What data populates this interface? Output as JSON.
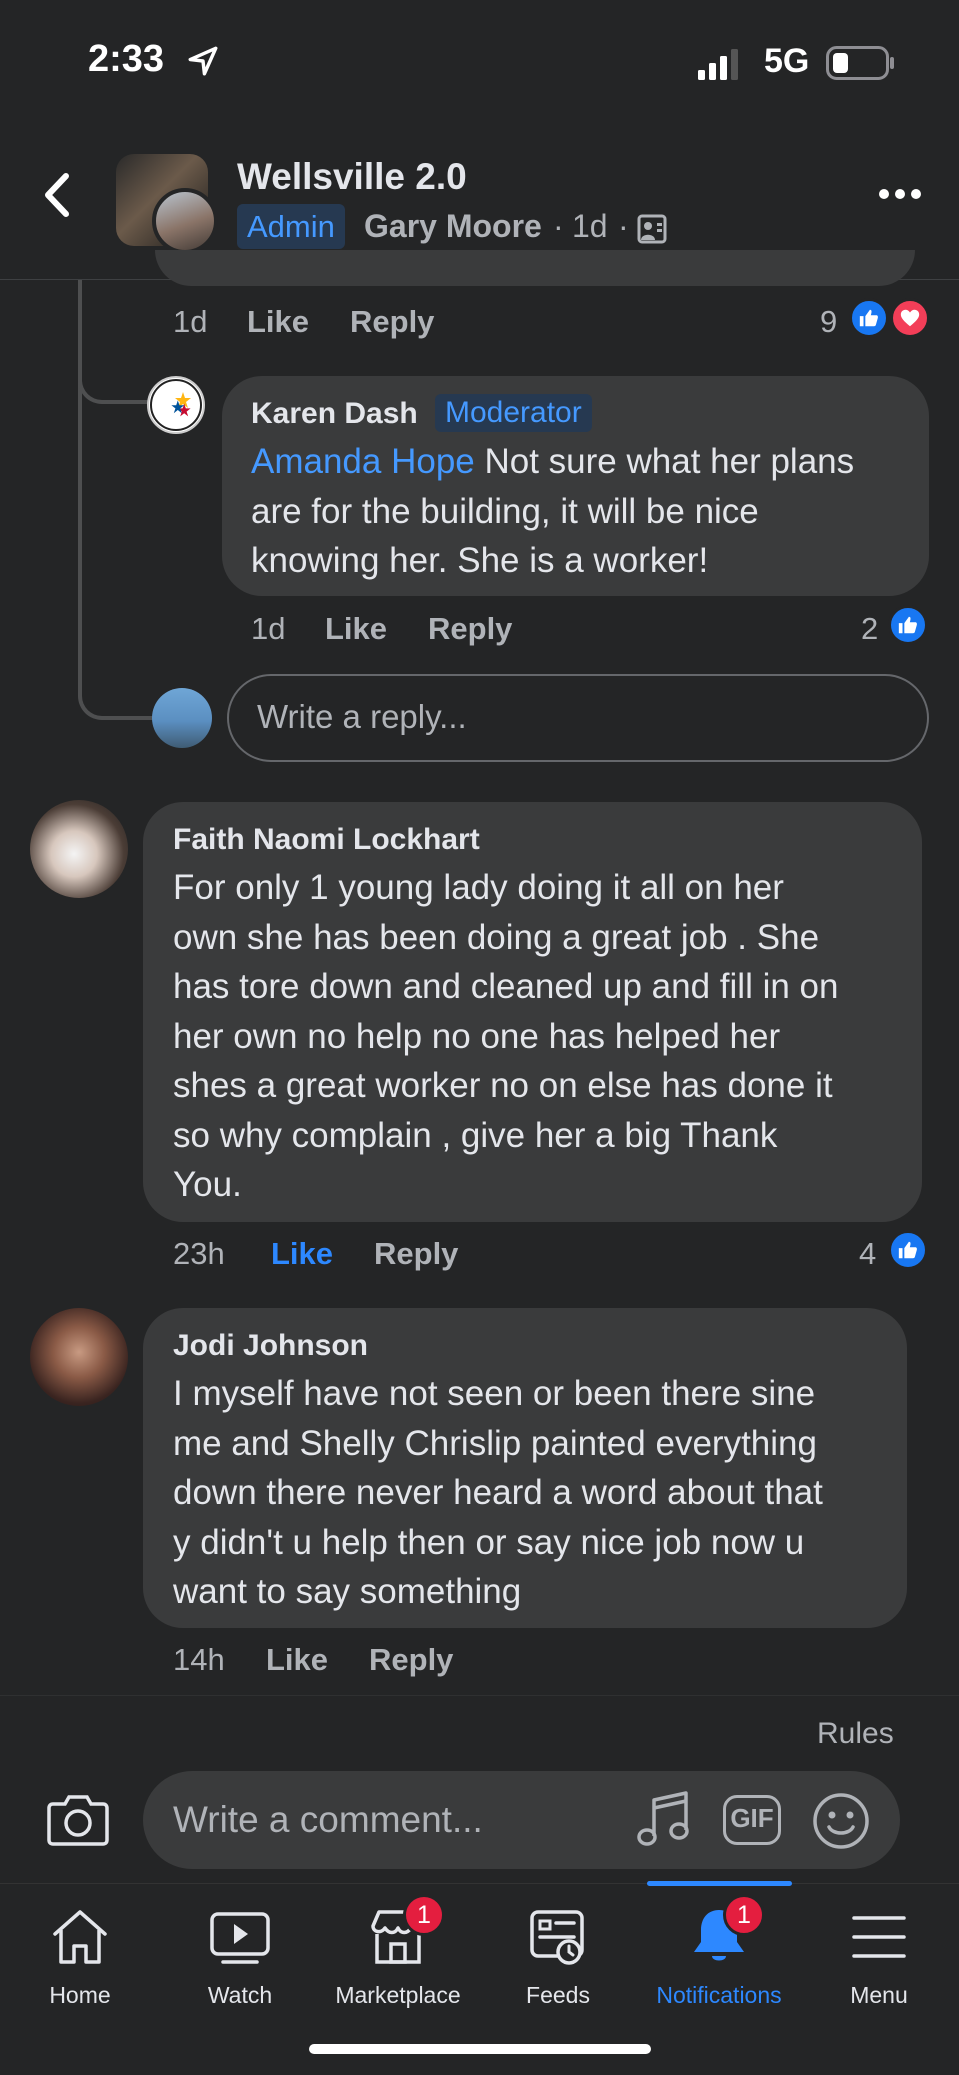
{
  "status_bar": {
    "time": "2:33",
    "network": "5G"
  },
  "header": {
    "group_name": "Wellsville 2.0",
    "role_badge": "Admin",
    "author": "Gary Moore",
    "time": "1d",
    "separator": "·"
  },
  "prev_comment_meta": {
    "time": "1d",
    "like": "Like",
    "reply": "Reply",
    "reaction_count": "9"
  },
  "reply_karen": {
    "name": "Karen Dash",
    "badge": "Moderator",
    "mention": "Amanda Hope",
    "text_line1": " Not sure what her plans",
    "text_line2": "are for the building, it will be nice",
    "text_line3": "knowing her. She is a worker!",
    "time": "1d",
    "like": "Like",
    "reply": "Reply",
    "reaction_count": "2"
  },
  "reply_box": {
    "placeholder": "Write a reply..."
  },
  "comments": [
    {
      "name": "Faith Naomi Lockhart",
      "lines": [
        "For only 1 young lady doing it all on her",
        "own she has been doing a great job . She",
        "has tore down and cleaned up and fill in on",
        "her own no help no one has helped her",
        "shes a great worker no on else has done it",
        "so why complain , give her a big Thank",
        "You."
      ],
      "time": "23h",
      "like": "Like",
      "reply": "Reply",
      "reaction_count": "4"
    },
    {
      "name": "Jodi Johnson",
      "lines": [
        "I myself have not seen or been there sine",
        "me and Shelly Chrislip painted everything",
        "down there never heard a word about that",
        "y didn't u help then or say nice job now u",
        "want to say something"
      ],
      "time": "14h",
      "like": "Like",
      "reply": "Reply"
    }
  ],
  "composer": {
    "rules": "Rules",
    "placeholder": "Write a comment...",
    "gif": "GIF"
  },
  "nav": {
    "items": [
      {
        "label": "Home",
        "icon": "home-icon"
      },
      {
        "label": "Watch",
        "icon": "video-icon"
      },
      {
        "label": "Marketplace",
        "icon": "store-icon",
        "badge": "1"
      },
      {
        "label": "Feeds",
        "icon": "feeds-icon"
      },
      {
        "label": "Notifications",
        "icon": "bell-icon",
        "badge": "1",
        "active": true
      },
      {
        "label": "Menu",
        "icon": "hamburger-icon"
      }
    ]
  },
  "colors": {
    "background": "#242526",
    "bubble": "#3a3b3c",
    "accent": "#2d88ff",
    "like_blue": "#1877f2",
    "badge_red": "#e41e3f"
  }
}
